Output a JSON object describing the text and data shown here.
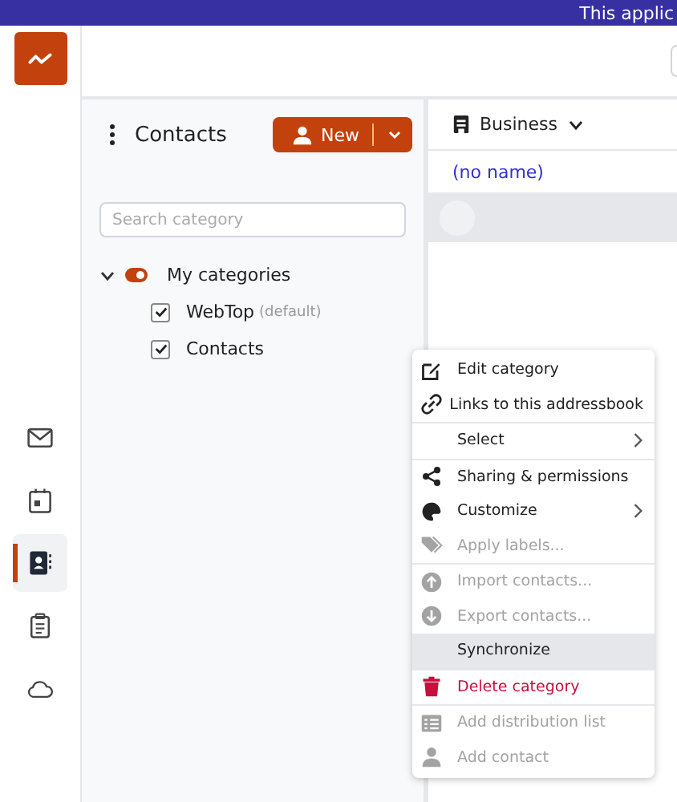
{
  "banner": {
    "text": "This applic"
  },
  "rail": [
    {
      "selected": false
    },
    {
      "selected": false
    },
    {
      "selected": true
    },
    {
      "selected": false
    },
    {
      "selected": false
    }
  ],
  "panel": {
    "title": "Contacts",
    "new_button": "New",
    "search": {
      "placeholder": "Search category"
    },
    "group": {
      "label": "My categories",
      "expanded": true,
      "on": true,
      "children": [
        {
          "label": "WebTop",
          "note": "(default)",
          "checked": true
        },
        {
          "label": "Contacts",
          "checked": true
        }
      ]
    }
  },
  "list": {
    "view": "Business",
    "rows": [
      {
        "kind": "name",
        "text": "(no name)"
      },
      {
        "kind": "avatar",
        "selected": true
      }
    ]
  },
  "menu": [
    {
      "kind": "item",
      "label": "Edit category",
      "disabled": false,
      "selected": false
    },
    {
      "kind": "item",
      "label": "Links to this addressbook",
      "disabled": false,
      "selected": false
    },
    {
      "kind": "divider"
    },
    {
      "kind": "submenu",
      "label": "Select",
      "disabled": false,
      "selected": false
    },
    {
      "kind": "divider"
    },
    {
      "kind": "item",
      "label": "Sharing & permissions",
      "disabled": false,
      "selected": false
    },
    {
      "kind": "submenu",
      "label": "Customize",
      "disabled": false,
      "selected": false
    },
    {
      "kind": "item",
      "label": "Apply labels...",
      "disabled": true,
      "selected": false
    },
    {
      "kind": "divider"
    },
    {
      "kind": "item",
      "label": "Import contacts...",
      "disabled": true,
      "selected": false
    },
    {
      "kind": "item",
      "label": "Export contacts...",
      "disabled": true,
      "selected": false
    },
    {
      "kind": "item",
      "label": "Synchronize",
      "disabled": false,
      "selected": true
    },
    {
      "kind": "divider"
    },
    {
      "kind": "item",
      "label": "Delete category",
      "disabled": false,
      "selected": false,
      "color": "#c8103e"
    },
    {
      "kind": "divider"
    },
    {
      "kind": "item",
      "label": "Add distribution list",
      "disabled": true,
      "selected": false
    },
    {
      "kind": "item",
      "label": "Add contact",
      "disabled": true,
      "selected": false
    }
  ]
}
